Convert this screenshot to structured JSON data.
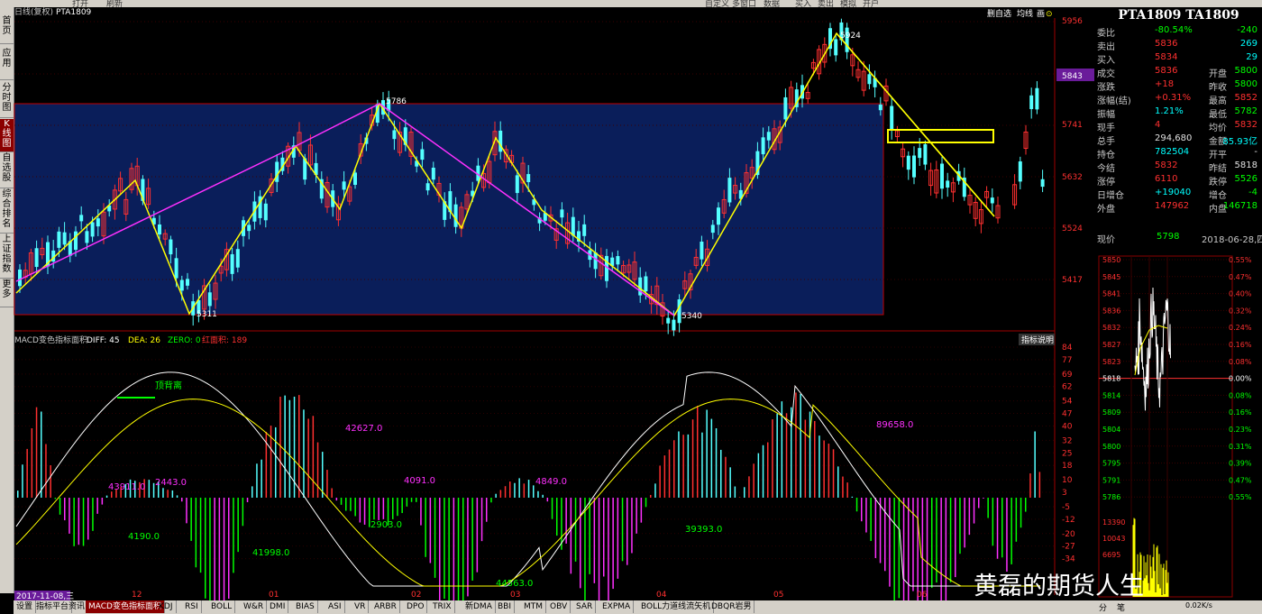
{
  "toolbar": {
    "left_items": [
      "打开",
      "刷新"
    ],
    "right_items": [
      "自定义",
      "多窗口",
      "数据",
      "买入",
      "卖出",
      "模拟",
      "开户"
    ]
  },
  "left_nav": [
    "首页",
    "应用",
    "分时图",
    "K线图",
    "自选股",
    "综合排名",
    "上证指数",
    "更多"
  ],
  "chart": {
    "period_label": "日线(复权)",
    "symbol": "PTA1809",
    "top_right_tools": [
      "删自选",
      "均线",
      "画",
      "⊙"
    ],
    "price_axis": [
      "5956",
      "5843",
      "5741",
      "5632",
      "5524",
      "5417"
    ],
    "current_price_tag": "5843",
    "annotations": {
      "high_peak": "5924",
      "mid_peak": "5786",
      "low_left": "5311",
      "low_mid": "5340"
    },
    "date_label": "2017-11-08,三",
    "x_months": [
      "12",
      "01",
      "02",
      "03",
      "04",
      "05",
      "06"
    ]
  },
  "macd": {
    "title": "MACD变色指标面积",
    "diff_label": "DIFF: 45",
    "dea_label": "DEA: 26",
    "zero_label": "ZERO: 0",
    "red_area_label": "红面积: 189",
    "help_button": "指标说明",
    "axis": [
      "84",
      "77",
      "69",
      "62",
      "54",
      "47",
      "40",
      "32",
      "25",
      "18",
      "10",
      "3",
      "-5",
      "-12",
      "-20",
      "-27",
      "-34"
    ],
    "divergence_label": "顶背离",
    "area_labels": [
      "43911.0",
      "2443.0",
      "4190.0",
      "41998.0",
      "42627.0",
      "2903.0",
      "4091.0",
      "4849.0",
      "44563.0",
      "39393.0",
      "89658.0"
    ]
  },
  "quote": {
    "title": "PTA1809 TA1809",
    "rows": [
      {
        "l1": "委比",
        "v1": "-80.54%",
        "c1": "#00ff00",
        "v2": "-240",
        "c2": "#00ff00"
      },
      {
        "l1": "卖出",
        "v1": "5836",
        "c1": "#ff3030",
        "v2": "269",
        "c2": "#00ffff"
      },
      {
        "l1": "买入",
        "v1": "5834",
        "c1": "#ff3030",
        "v2": "29",
        "c2": "#00ffff"
      },
      {
        "l1": "成交",
        "v1": "5836",
        "c1": "#ff3030",
        "l2": "开盘",
        "v2": "5800",
        "c2": "#00ff00"
      },
      {
        "l1": "涨跌",
        "v1": "+18",
        "c1": "#ff3030",
        "l2": "昨收",
        "v2": "5800",
        "c2": "#00ff00"
      },
      {
        "l1": "涨幅(结)",
        "v1": "+0.31%",
        "c1": "#ff3030",
        "l2": "最高",
        "v2": "5852",
        "c2": "#ff3030"
      },
      {
        "l1": "振幅",
        "v1": "1.21%",
        "c1": "#00ffff",
        "l2": "最低",
        "v2": "5782",
        "c2": "#00ff00"
      },
      {
        "l1": "现手",
        "v1": "4",
        "c1": "#ff3030",
        "l2": "均价",
        "v2": "5832",
        "c2": "#ff3030"
      },
      {
        "l1": "总手",
        "v1": "294,680",
        "c1": "#e0e0e0",
        "l2": "金额",
        "v2": "85.93亿",
        "c2": "#00ffff"
      },
      {
        "l1": "持仓",
        "v1": "782504",
        "c1": "#00ffff",
        "l2": "开平",
        "v2": "-",
        "c2": "#e0e0e0"
      },
      {
        "l1": "今结",
        "v1": "5832",
        "c1": "#ff3030",
        "l2": "昨结",
        "v2": "5818",
        "c2": "#e0e0e0"
      },
      {
        "l1": "涨停",
        "v1": "6110",
        "c1": "#ff3030",
        "l2": "跌停",
        "v2": "5526",
        "c2": "#00ff00"
      },
      {
        "l1": "日增仓",
        "v1": "+19040",
        "c1": "#00ffff",
        "l2": "增仓",
        "v2": "-4",
        "c2": "#00ff00"
      },
      {
        "l1": "外盘",
        "v1": "147962",
        "c1": "#ff3030",
        "l2": "内盘",
        "v2": "146718",
        "c2": "#00ff00"
      }
    ],
    "current_price_label": "现价",
    "current_price": "5798",
    "date": "2018-06-28,四",
    "mini_prices": [
      "5850",
      "5845",
      "5841",
      "5836",
      "5832",
      "5827",
      "5823",
      "5818",
      "5814",
      "5809",
      "5804",
      "5800",
      "5795",
      "5791",
      "5786"
    ],
    "mini_pcts": [
      "0.55%",
      "0.47%",
      "0.40%",
      "0.32%",
      "0.24%",
      "0.16%",
      "0.08%",
      "0.00%",
      "0.08%",
      "0.16%",
      "0.23%",
      "0.31%",
      "0.39%",
      "0.47%",
      "0.55%"
    ],
    "volume_axis": [
      "13390",
      "10043",
      "6695"
    ],
    "bottom_tabs": [
      "分",
      "笔"
    ],
    "speed": "0.02K/s"
  },
  "bottom_tabs": [
    "设置",
    "指标平台",
    "资讯",
    "MACD变色指标面积",
    "KDJ",
    "RSI",
    "BOLL",
    "W&R",
    "DMI",
    "BIAS",
    "ASI",
    "VR",
    "ARBR",
    "DPO",
    "TRIX",
    "新DMA",
    "BBI",
    "MTM",
    "OBV",
    "SAR",
    "EXPMA",
    "BOLL力道线流矢机",
    "DBQR岩男"
  ],
  "watermark": "黄磊的期货人生",
  "colors": {
    "up": "#ff3030",
    "down": "#54ffff",
    "panel_bg": "#0a1e5a",
    "frame": "#c00000"
  }
}
